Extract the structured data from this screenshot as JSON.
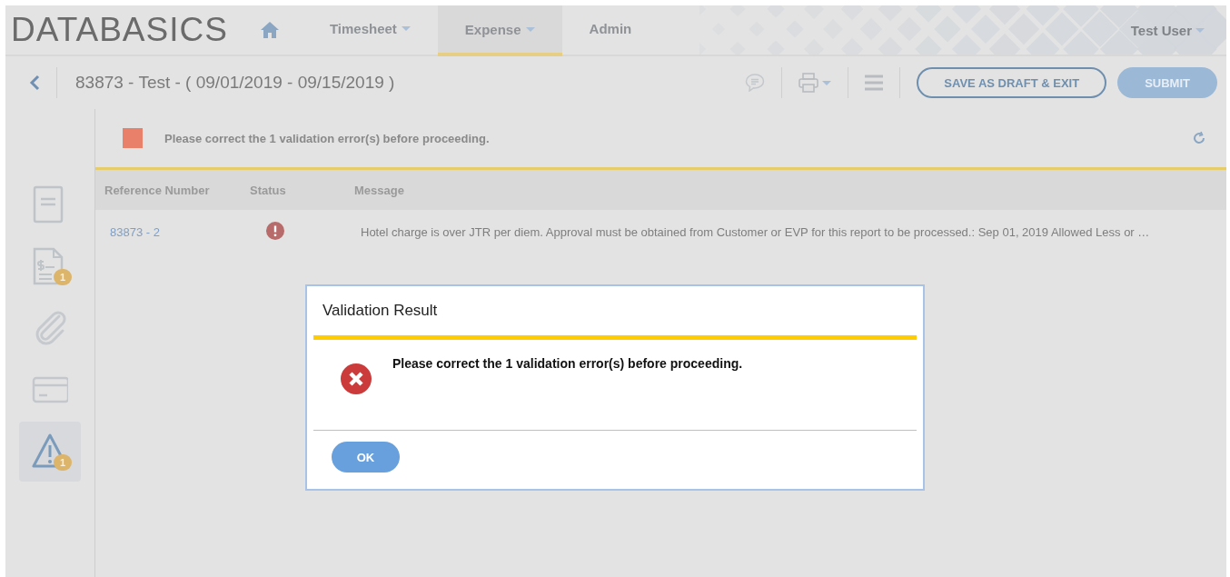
{
  "header": {
    "logo": "DATABASICS",
    "tabs": [
      {
        "label": "Timesheet",
        "dropdown": true,
        "selected": false
      },
      {
        "label": "Expense",
        "dropdown": true,
        "selected": true
      },
      {
        "label": "Admin",
        "dropdown": false,
        "selected": false
      }
    ],
    "user": "Test User"
  },
  "toolbar": {
    "title": "83873 - Test - ( 09/01/2019 - 09/15/2019 )",
    "buttons": [
      {
        "label": "SAVE AS DRAFT & EXIT",
        "kind": "outline"
      },
      {
        "label": "SUBMIT",
        "kind": "filled"
      }
    ]
  },
  "sidebar": {
    "items": [
      {
        "kind": "document",
        "selected": false
      },
      {
        "kind": "receipt",
        "badge": "1",
        "selected": false
      },
      {
        "kind": "attachment",
        "selected": false
      },
      {
        "kind": "card",
        "selected": false
      },
      {
        "kind": "warning",
        "badge": "1",
        "selected": true
      }
    ]
  },
  "alert": {
    "color": "#e8806a",
    "message": "Please correct the 1 validation error(s) before proceeding."
  },
  "table": {
    "columns": [
      "Reference Number",
      "Status",
      "Message"
    ],
    "rows": [
      {
        "reference": "83873 - 2",
        "kind": "error",
        "message": "Hotel charge is over JTR per diem. Approval must be obtained from Customer or EVP for this report to be processed.: Sep 01, 2019 Allowed Less or …"
      }
    ]
  },
  "dialog": {
    "title": "Validation Result",
    "message": "Please correct the 1 validation error(s) before proceeding.",
    "button": "OK"
  }
}
